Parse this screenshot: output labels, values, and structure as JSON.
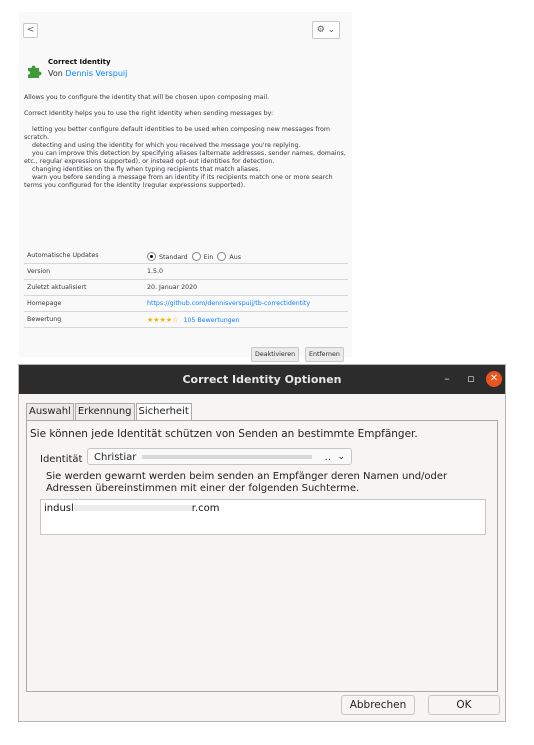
{
  "addon": {
    "back_glyph": "<",
    "gear_glyph": "⚙ ⌄",
    "title": "Correct Identity",
    "author_prefix": "Von",
    "author": "Dennis Verspuij",
    "summary": "Allows you to configure the identity that will be chosen upon composing mail.",
    "intro": "Correct Identity helps you to use the right identity when sending messages by:",
    "features": [
      "    letting you better configure default identities to be used when composing new messages from scratch.",
      "    detecting and using the identity for which you received the message you're replying.",
      "    you can improve this detection by specifying aliases (alternate addresses, sender names, domains, etc., regular expressions supported), or instead opt-out identities for detection.",
      "    changing identities on the fly when typing recipients that match aliases.",
      "    warn you before sending a message from an identity if its recipients match one or more search terms you configured for the identity (regular expressions supported)."
    ],
    "rows": {
      "updates_label": "Automatische Updates",
      "updates_opt1": "Standard",
      "updates_opt2": "Ein",
      "updates_opt3": "Aus",
      "version_label": "Version",
      "version_value": "1.5.0",
      "updated_label": "Zuletzt aktualisiert",
      "updated_value": "20. Januar 2020",
      "homepage_label": "Homepage",
      "homepage_value": "https://github.com/dennisverspuij/tb-correctidentity",
      "rating_label": "Bewertung",
      "rating_stars": "★★★★☆",
      "rating_value": 4,
      "rating_count": "105 Bewertungen"
    },
    "btn_disable": "Deaktivieren",
    "btn_remove": "Entfernen"
  },
  "dialog": {
    "title": "Correct Identity Optionen",
    "minimize_glyph": "–",
    "maximize_glyph": "▫",
    "close_glyph": "✕",
    "tabs": [
      "Auswahl",
      "Erkennung",
      "Sicherheit"
    ],
    "active_tab": "Sicherheit",
    "intro": "Sie können jede Identität schützen von Senden an bestimmte Empfänger.",
    "identity_label": "Identität",
    "identity_value": "Christiar",
    "identity_suffix": "..",
    "warning": "Sie werden gewarnt werden beim senden an Empfänger deren Namen und/oder Adressen übereinstimmen mit einer der folgenden Suchterme.",
    "terms_prefix": "indusl",
    "terms_suffix": "r.com",
    "cancel": "Abbrechen",
    "ok": "OK"
  },
  "colors": {
    "link": "#0a84ff",
    "titlebar": "#2c2c2c",
    "close": "#e95420",
    "star": "#f4b400"
  }
}
